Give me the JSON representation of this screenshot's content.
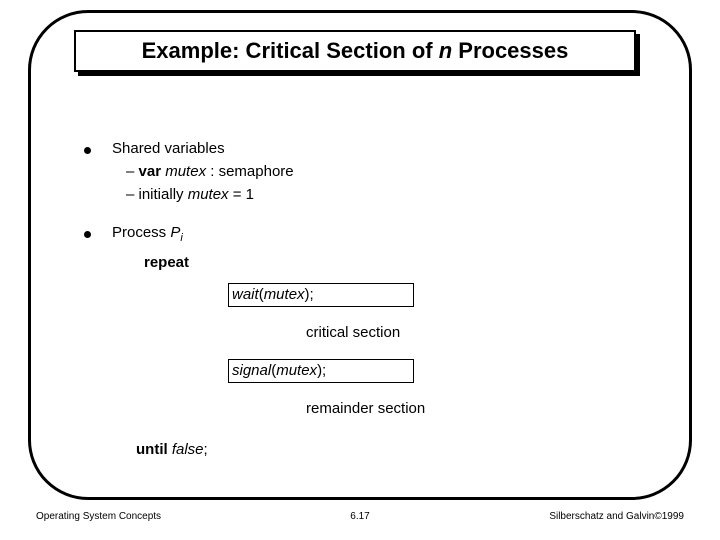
{
  "title": {
    "pre": "Example:  Critical Section of ",
    "n": "n",
    "post": " Processes"
  },
  "b1": {
    "head": "Shared variables",
    "s1_pre": "–   ",
    "s1_var": "var ",
    "s1_mutex": "mutex",
    "s1_post": " : semaphore",
    "s2_pre": "–   initially ",
    "s2_mutex": "mutex",
    "s2_post": " = 1"
  },
  "b2": {
    "head_pre": "Process ",
    "head_p": "P",
    "head_i": "i"
  },
  "repeat": "repeat",
  "wait": {
    "fn": "wait",
    "lp": "(",
    "arg": "mutex",
    "rp": ");"
  },
  "crit": "critical section",
  "signal": {
    "fn": "signal",
    "lp": "(",
    "arg": "mutex",
    "rp": ");"
  },
  "rem": "remainder section",
  "until": {
    "kw": "until ",
    "val": "false",
    "semi": ";"
  },
  "footer": {
    "left": "Operating System Concepts",
    "center": "6.17",
    "right_pre": "Silberschatz and Galvin",
    "right_c": "©",
    "right_post": "1999"
  }
}
